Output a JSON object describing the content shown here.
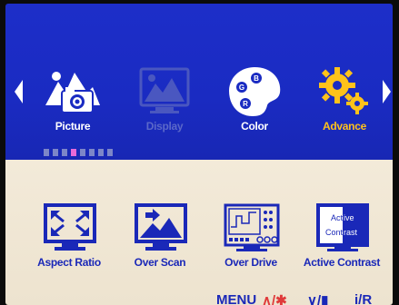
{
  "top_menu": {
    "items": [
      {
        "label": "Picture",
        "icon": "picture-camera-icon",
        "state": "normal"
      },
      {
        "label": "Display",
        "icon": "display-icon",
        "state": "disabled"
      },
      {
        "label": "Color",
        "icon": "color-palette-icon",
        "state": "normal"
      },
      {
        "label": "Advance",
        "icon": "gear-icon",
        "state": "selected"
      }
    ],
    "page_indicator": {
      "count": 8,
      "current_index": 3
    }
  },
  "sub_menu": {
    "items": [
      {
        "label": "Aspect Ratio",
        "icon": "aspect-ratio-icon"
      },
      {
        "label": "Over Scan",
        "icon": "over-scan-icon"
      },
      {
        "label": "Over Drive",
        "icon": "over-drive-icon"
      },
      {
        "label": "Active Contrast",
        "icon": "active-contrast-icon"
      }
    ],
    "active_contrast_icon_text": [
      "Active",
      "Contrast"
    ]
  },
  "footer": {
    "menu": "MENU",
    "up": "∧/✱",
    "down": "∨/▮",
    "info": "i/R"
  },
  "colors": {
    "top_bg": "#1d2ec9",
    "bottom_bg": "#f3ead9",
    "selected": "#ffc21a",
    "text_blue": "#1a28b8",
    "accent_red": "#e03a3a"
  }
}
